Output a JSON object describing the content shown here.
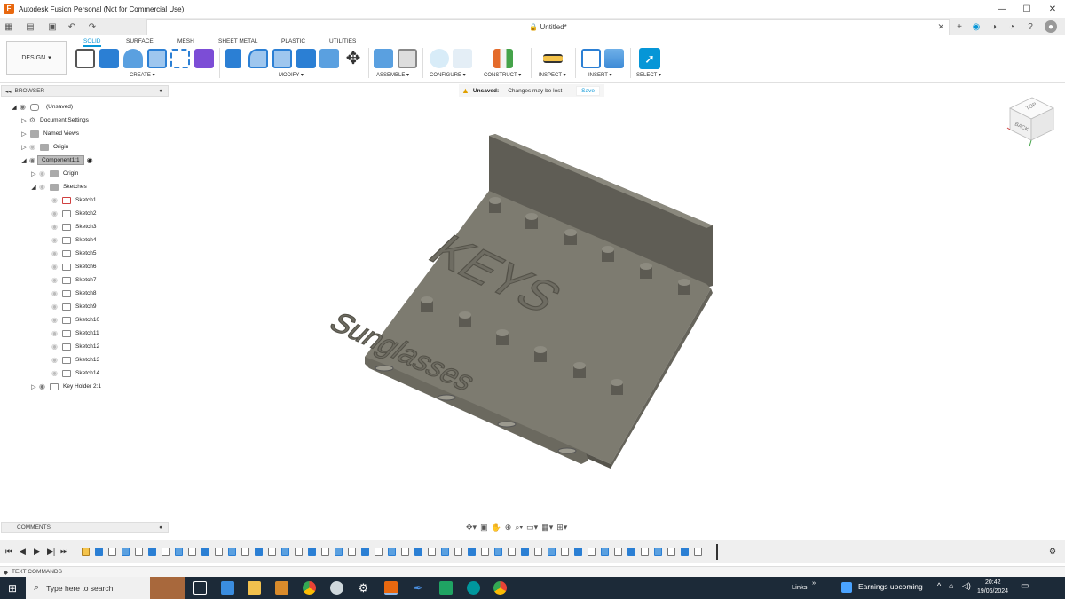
{
  "window": {
    "title": "Autodesk Fusion Personal (Not for Commercial Use)",
    "minimize": "—",
    "maximize": "☐",
    "close": "✕"
  },
  "document": {
    "tab_title": "Untitled*",
    "lock_icon": "lock-icon"
  },
  "ribbon": {
    "workspace": "DESIGN",
    "tabs": [
      "SOLID",
      "SURFACE",
      "MESH",
      "SHEET METAL",
      "PLASTIC",
      "UTILITIES"
    ],
    "active_tab": "SOLID",
    "groups": {
      "create": "CREATE",
      "modify": "MODIFY",
      "assemble": "ASSEMBLE",
      "configure": "CONFIGURE",
      "construct": "CONSTRUCT",
      "inspect": "INSPECT",
      "insert": "INSERT",
      "select": "SELECT"
    }
  },
  "unsaved_bar": {
    "label": "Unsaved:",
    "message": "Changes may be lost",
    "save": "Save"
  },
  "browser": {
    "header": "BROWSER",
    "root": "(Unsaved)",
    "items": {
      "document_settings": "Document Settings",
      "named_views": "Named Views",
      "origin": "Origin",
      "component": "Component1:1",
      "comp_origin": "Origin",
      "sketches": "Sketches",
      "key_holder": "Key Holder 2:1"
    },
    "sketches": [
      "Sketch1",
      "Sketch2",
      "Sketch3",
      "Sketch4",
      "Sketch5",
      "Sketch6",
      "Sketch7",
      "Sketch8",
      "Sketch9",
      "Sketch10",
      "Sketch11",
      "Sketch12",
      "Sketch13",
      "Sketch14"
    ]
  },
  "comments": {
    "header": "COMMENTS"
  },
  "text_commands": {
    "label": "TEXT COMMANDS"
  },
  "model": {
    "emboss_top": "KEYS",
    "emboss_bottom": "Sunglasses"
  },
  "viewcube": {
    "top": "TOP",
    "back": "BACK"
  },
  "taskbar": {
    "search_placeholder": "Type here to search",
    "links": "Links",
    "news": "Earnings upcoming",
    "time": "20:42",
    "date": "19/06/2024"
  },
  "colors": {
    "accent": "#0696d7",
    "model": "#7d7b70",
    "taskbar": "#1c2a38"
  }
}
